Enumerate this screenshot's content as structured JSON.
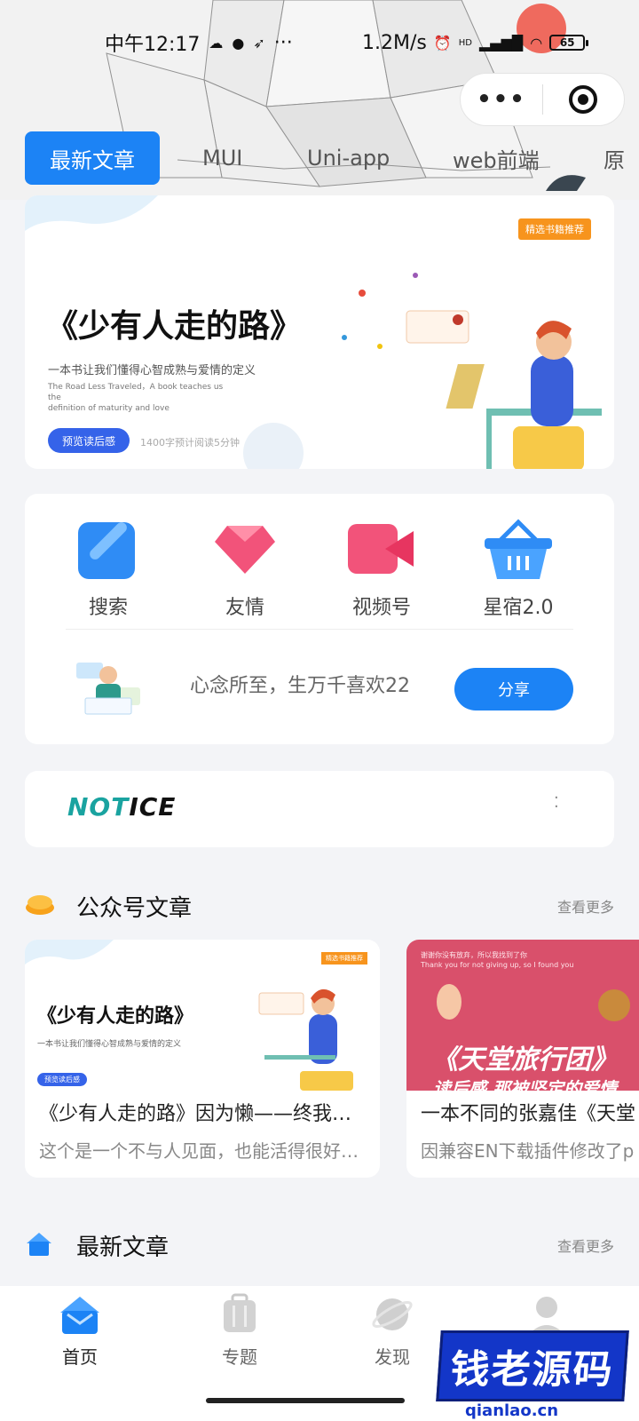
{
  "status_bar": {
    "time": "中午12:17",
    "dots": "···",
    "net_speed": "1.2M/s",
    "signal": "HD",
    "battery": "65"
  },
  "capsule": {
    "more": "•••"
  },
  "tabs": [
    {
      "label": "最新文章",
      "active": true
    },
    {
      "label": "MUI",
      "active": false
    },
    {
      "label": "Uni-app",
      "active": false
    },
    {
      "label": "web前端",
      "active": false
    },
    {
      "label": "原",
      "active": false
    }
  ],
  "banner": {
    "badge": "精选书籍推荐",
    "title": "《少有人走的路》",
    "subtitle": "一本书让我们懂得心智成熟与爱情的定义",
    "subtitle_en_1": "The Road Less Traveled，A book teaches us the",
    "subtitle_en_2": "definition of maturity and love",
    "button": "预览读后感",
    "read_info": "1400字预计阅读5分钟"
  },
  "features": [
    {
      "label": "搜索",
      "icon": "edit-icon",
      "color": "#2f8cf5"
    },
    {
      "label": "友情",
      "icon": "diamond-icon",
      "color": "#f2537a"
    },
    {
      "label": "视频号",
      "icon": "video-icon",
      "color": "#f2537a"
    },
    {
      "label": "星宿2.0",
      "icon": "basket-icon",
      "color": "#2f8cf5"
    }
  ],
  "share": {
    "text": "心念所至，生万千喜欢22",
    "button": "分享"
  },
  "notice": {
    "logo_a": "NOT",
    "logo_b": "ICE",
    "dots": "·\n·"
  },
  "section_gzh": {
    "title": "公众号文章",
    "more": "查看更多"
  },
  "articles": [
    {
      "title": "《少有人走的路》因为懒——终我…",
      "desc": "这个是一个不与人见面，也能活得很好…",
      "thumb": {
        "title": "《少有人走的路》",
        "sub": "一本书让我们懂得心智成熟与爱情的定义",
        "btn": "预览读后感",
        "badge": "精选书籍推荐"
      }
    },
    {
      "title": "一本不同的张嘉佳《天堂",
      "desc": "因兼容EN下载插件修改了p",
      "thumb": {
        "sub": "谢谢你没有放弃，所以我找到了你",
        "sub_en": "Thank you for not giving up, so I found you",
        "title": "《天堂旅行团》",
        "sub2": "读后感 那被坚定的爱情"
      }
    }
  ],
  "section_latest": {
    "title": "最新文章",
    "more": "查看更多"
  },
  "tabbar": [
    {
      "label": "首页",
      "icon": "home-icon",
      "active": true
    },
    {
      "label": "专题",
      "icon": "luggage-icon",
      "active": false
    },
    {
      "label": "发现",
      "icon": "planet-icon",
      "active": false
    },
    {
      "label": "",
      "icon": "user-icon",
      "active": false
    }
  ],
  "watermark": {
    "text": "钱老源码",
    "url": "qianlao.cn"
  },
  "colors": {
    "primary": "#1c83f5",
    "pink": "#f2537a",
    "orange": "#f7941d"
  }
}
